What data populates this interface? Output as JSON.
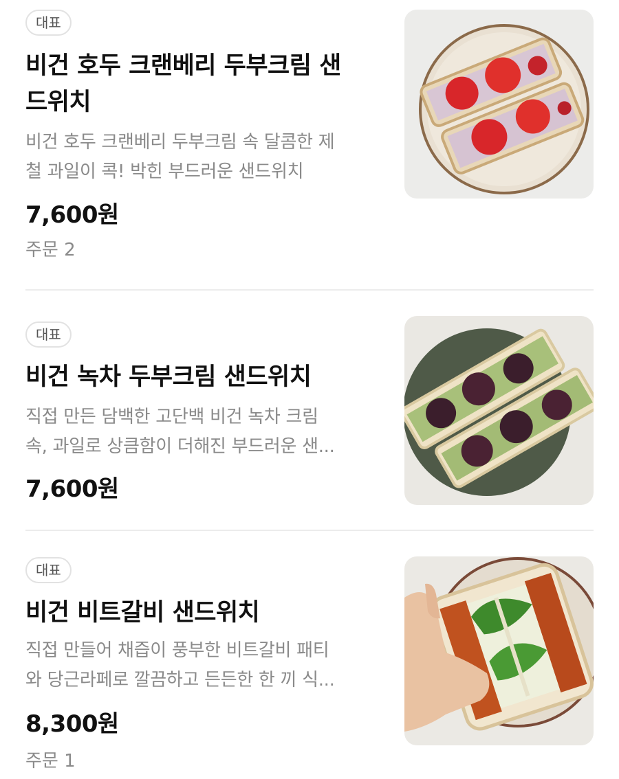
{
  "items": [
    {
      "badge": "대표",
      "title_line1": "비건 호두 크랜베리 두부크림 샌",
      "title_line2": "드위치",
      "desc_line1": "비건 호두 크랜베리 두부크림 속 달콤한 제",
      "desc_line2": "철 과일이 콕! 박힌 부드러운 샌드위치",
      "price": "7,600원",
      "orders": "주문 2",
      "image_icon": "strawberry-sandwich-image"
    },
    {
      "badge": "대표",
      "title_line1": "비건 녹차 두부크림 샌드위치",
      "desc_line1": "직접 만든 담백한 고단백 비건 녹차 크림",
      "desc_line2": "속, 과일로 상큼함이 더해진 부드러운 샌...",
      "price": "7,600원",
      "image_icon": "greentea-grape-sandwich-image"
    },
    {
      "badge": "대표",
      "title_line1": "비건 비트갈비 샌드위치",
      "desc_line1": "직접 만들어 채즙이 풍부한 비트갈비 패티",
      "desc_line2": "와 당근라페로 깔끔하고 든든한 한 끼 식...",
      "price": "8,300원",
      "orders": "주문 1",
      "image_icon": "beet-galbi-sandwich-image"
    }
  ],
  "colors": {
    "text_primary": "#111111",
    "text_secondary": "#8a8a8a",
    "badge_border": "#e2e2e2",
    "divider": "#ececec"
  }
}
